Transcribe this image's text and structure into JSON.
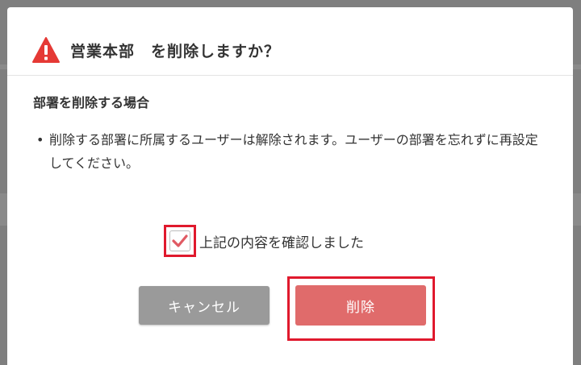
{
  "dialog": {
    "title": "営業本部　を削除しますか？",
    "section_heading": "部署を削除する場合",
    "bullet_marker": "•",
    "bullet_text": "削除する部署に所属するユーザーは解除されます。ユーザーの部署を忘れずに再設定してください。",
    "confirm_label": "上記の内容を確認しました",
    "confirm_checked": true,
    "cancel_label": "キャンセル",
    "delete_label": "削除"
  },
  "colors": {
    "warning": "#e53935",
    "check": "#e05a63",
    "highlight": "#e0192d",
    "delete_button": "#e06b6b",
    "cancel_button": "#9a9a9a"
  },
  "icons": {
    "warning": "warning-triangle-icon",
    "check": "checkmark-icon"
  }
}
